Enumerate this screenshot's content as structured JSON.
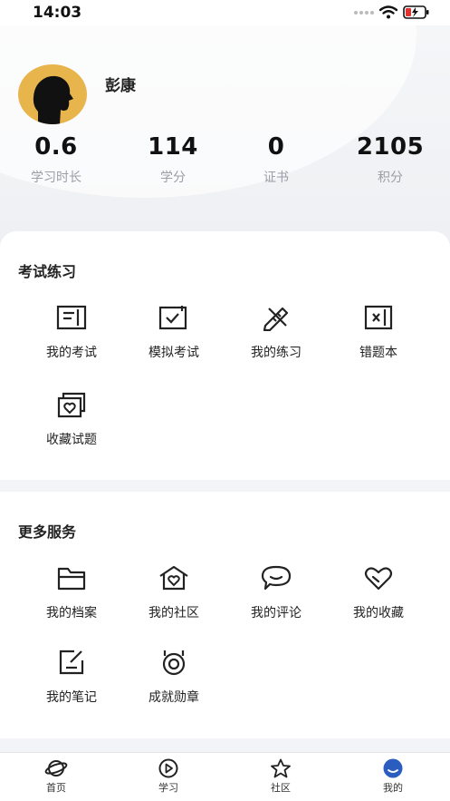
{
  "status_bar": {
    "time": "14:03"
  },
  "profile": {
    "username": "彭康"
  },
  "stats": [
    {
      "value": "0.6",
      "label": "学习时长"
    },
    {
      "value": "114",
      "label": "学分"
    },
    {
      "value": "0",
      "label": "证书"
    },
    {
      "value": "2105",
      "label": "积分"
    }
  ],
  "exam_section": {
    "title": "考试练习",
    "items": [
      {
        "label": "我的考试",
        "icon": "exam-paper-icon"
      },
      {
        "label": "模拟考试",
        "icon": "mock-exam-icon"
      },
      {
        "label": "我的练习",
        "icon": "pencil-ruler-icon"
      },
      {
        "label": "错题本",
        "icon": "wrong-book-icon"
      },
      {
        "label": "收藏试题",
        "icon": "favorite-questions-icon"
      }
    ]
  },
  "service_section": {
    "title": "更多服务",
    "items": [
      {
        "label": "我的档案",
        "icon": "folder-icon"
      },
      {
        "label": "我的社区",
        "icon": "community-home-icon"
      },
      {
        "label": "我的评论",
        "icon": "comment-bubble-icon"
      },
      {
        "label": "我的收藏",
        "icon": "heart-icon"
      },
      {
        "label": "我的笔记",
        "icon": "note-edit-icon"
      },
      {
        "label": "成就勋章",
        "icon": "medal-icon"
      }
    ]
  },
  "tabbar": {
    "tabs": [
      {
        "label": "首页",
        "icon": "home-planet-icon"
      },
      {
        "label": "学习",
        "icon": "play-circle-icon"
      },
      {
        "label": "社区",
        "icon": "star-icon"
      },
      {
        "label": "我的",
        "icon": "profile-avatar-icon"
      }
    ],
    "active": "我的"
  },
  "colors": {
    "avatar_bg": "#e8b44c",
    "label_gray": "#9a9ea6",
    "active_tab": "#2b5dbf"
  }
}
